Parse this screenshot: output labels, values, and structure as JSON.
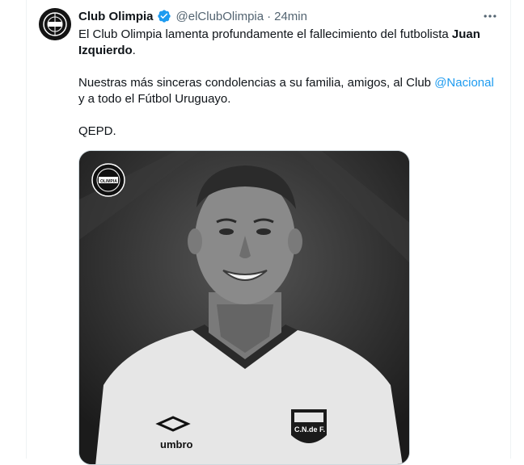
{
  "tweet": {
    "author_name": "Club Olimpia",
    "handle": "@elClubOlimpia",
    "separator": "·",
    "time": "24min",
    "para1_pre": "El Club Olimpia lamenta profundamente el fallecimiento del futbolista ",
    "para1_bold": "Juan Izquierdo",
    "para1_post": ".",
    "para2_pre": "Nuestras más sinceras condolencias a su familia, amigos, al Club ",
    "para2_mention": "@Nacional",
    "para2_post": " y a todo el Fútbol Uruguayo.",
    "para3": "QEPD."
  },
  "image": {
    "crest_text": "OLIMPIA",
    "kit_brand": "umbro",
    "badge_text": "C.N.de F."
  },
  "colors": {
    "accent": "#1d9bf0",
    "text": "#0f1419",
    "muted": "#536471"
  },
  "icons": {
    "verified": "verified-badge-icon",
    "more": "more-options-icon"
  }
}
